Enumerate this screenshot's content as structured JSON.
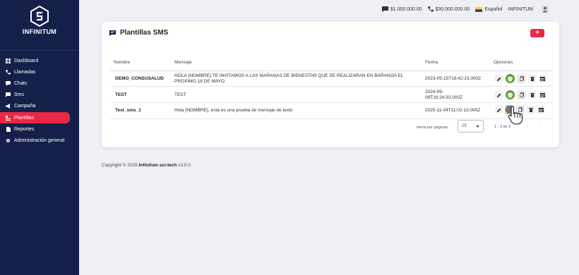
{
  "brand": {
    "name": "INFINITUM"
  },
  "sidebar": {
    "items": [
      {
        "label": "Dashboard",
        "icon": "grid-icon"
      },
      {
        "label": "Llamadas",
        "icon": "phone-icon"
      },
      {
        "label": "Chats",
        "icon": "chat-icon"
      },
      {
        "label": "Sms",
        "icon": "message-icon"
      },
      {
        "label": "Campaña",
        "icon": "megaphone-icon"
      },
      {
        "label": "Plantillas",
        "icon": "template-icon",
        "active": true
      },
      {
        "label": "Reportes",
        "icon": "document-icon"
      },
      {
        "label": "Administración general",
        "icon": "gear-icon"
      }
    ]
  },
  "topbar": {
    "balance_1": "$1.000.000.00",
    "balance_2": "$30.000.000.00",
    "language": "Español",
    "account": "INFINITUM"
  },
  "card": {
    "title": "Plantillas SMS",
    "add_label": "+",
    "columns": {
      "nombre": "Nombre",
      "mensaje": "Mensaje",
      "fecha": "Fecha",
      "opciones": "Opciones"
    },
    "rows": [
      {
        "nombre": "DEMO_CONSUSALUD",
        "mensaje": "HOLA {NOMBRE} TE INVITAMOS A LAS MAÑANAS DE BIENESTAR QUE SE REALIZARAN EN BARANOA EL PROXIMO 18 DE MAYO",
        "fecha": "2023-05-15T16:42:23.000Z"
      },
      {
        "nombre": "TEST",
        "mensaje": "TEST",
        "fecha": "2024-09-09T16:24:33.000Z"
      },
      {
        "nombre": "Test_sms_1",
        "mensaje": "Hola {NOMBRE}, esta es una prueba de mensaje de texto",
        "fecha": "2025-11-04T11:02:13.000Z"
      }
    ],
    "pager": {
      "items_per_page_label": "Items por páginas:",
      "items_per_page": "25",
      "range": "1 - 3 de 3"
    }
  },
  "footer": {
    "prefix": "Copyright © 2025 ",
    "company": "Infinitum sci-tech",
    "version": " v3.0.0"
  },
  "colors": {
    "sidebar": "#14204a",
    "accent": "#ea2845",
    "approve": "#5c9a3a"
  }
}
